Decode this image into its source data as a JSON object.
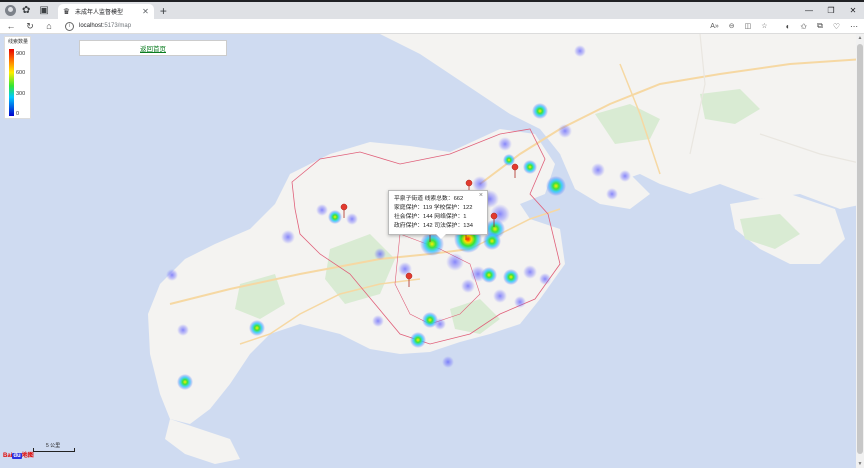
{
  "browser": {
    "tab_title": "未成年人监督模型",
    "url_host": "localhost",
    "url_path": ":5173/map",
    "icons": {
      "profile": "profile-avatar-icon",
      "extensions": "extensions-icon",
      "tab_actions": "tab-actions-icon",
      "tab_favicon": "trophy-icon",
      "close": "close-icon",
      "new_tab": "plus-icon",
      "back": "back-arrow-icon",
      "reload": "reload-icon",
      "home": "home-icon",
      "info": "info-icon",
      "read_aloud": "read-aloud-icon",
      "zoom": "zoom-icon",
      "split": "split-screen-icon",
      "favorite": "star-icon",
      "copilot": "copilot-icon",
      "favorites_bar": "favorites-icon",
      "collections": "collections-icon",
      "browser_essentials": "heart-pulse-icon",
      "more": "more-icon"
    },
    "window_controls": [
      "—",
      "❐",
      "✕"
    ]
  },
  "map": {
    "back_label": "返回首页",
    "legend": {
      "title": "线索数量",
      "ticks": [
        "900",
        "600",
        "300",
        "0"
      ],
      "colors": [
        "#e60000",
        "#ff7a00",
        "#ffee00",
        "#33e533",
        "#00c8ff",
        "#0000cc"
      ]
    },
    "popup": {
      "line1": "平泉子街道 线索总数：662",
      "line2": "家庭保护：119 学校保护：122",
      "line3": "社会保护：144 网络保护：1",
      "line4": "政府保护：142 司法保护：134",
      "close": "×"
    },
    "attribution": {
      "logo_a": "Bai",
      "logo_b": "du",
      "logo_c": "地图"
    },
    "scale_label": "5 公里"
  }
}
